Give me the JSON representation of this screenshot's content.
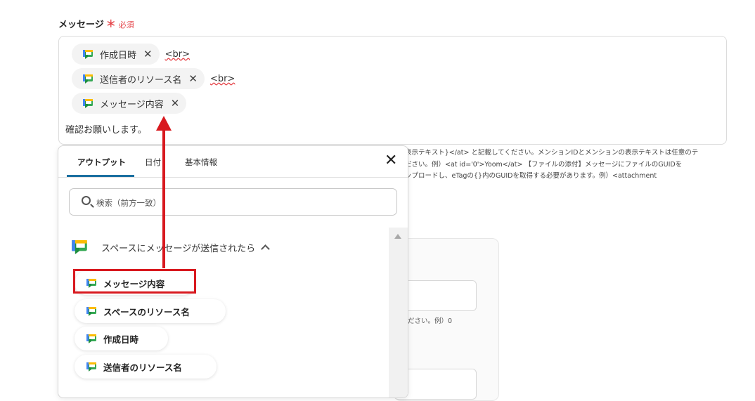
{
  "field": {
    "label": "メッセージ",
    "required_mark": "＊",
    "required_text": "必須"
  },
  "editor": {
    "chips": [
      {
        "label": "作成日時",
        "trailing": "<br>"
      },
      {
        "label": "送信者のリソース名",
        "trailing": "<br>"
      },
      {
        "label": "メッセージ内容",
        "trailing": ""
      }
    ],
    "text": "確認お願いします。"
  },
  "help_lines": [
    "表示テキスト}</at> と記載してください。メンションIDとメンションの表示テキストは任意のテ",
    "ださい。例）<at id='0'>Yoom</at> 【ファイルの添付】メッセージにファイルのGUIDを",
    "ップロードし、eTagの{}内のGUIDを取得する必要があります。例）<attachment"
  ],
  "background_text": "ださい。例）0",
  "popup": {
    "tabs": [
      "アウトプット",
      "日付",
      "基本情報"
    ],
    "active_tab": "アウトプット",
    "search_placeholder": "検索（前方一致）",
    "section_title": "スペースにメッセージが送信されたら",
    "items": [
      "メッセージ内容",
      "スペースのリソース名",
      "作成日時",
      "送信者のリソース名"
    ]
  },
  "colors": {
    "required": "#e5484d",
    "annotation": "#d8191f",
    "tab_active": "#1a6fa0"
  },
  "icons": {
    "chip": "google-chat-icon",
    "close": "close-icon",
    "search": "search-icon"
  }
}
